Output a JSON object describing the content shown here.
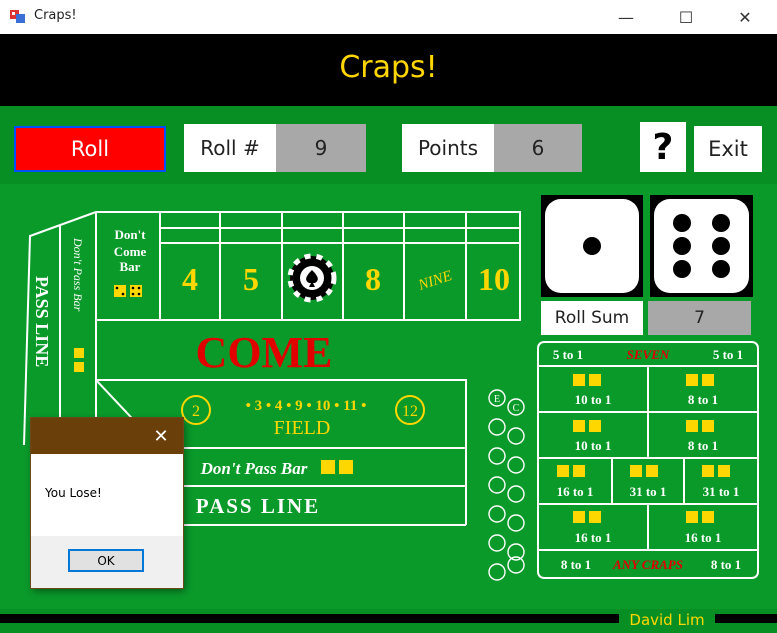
{
  "window": {
    "title": "Craps!",
    "minimize_glyph": "—",
    "maximize_glyph": "☐",
    "close_glyph": "✕"
  },
  "header": {
    "title": "Craps!"
  },
  "toolbar": {
    "roll_label": "Roll",
    "roll_number_label": "Roll  #",
    "roll_number_value": "9",
    "points_label": "Points",
    "points_value": "6",
    "help_label": "?",
    "exit_label": "Exit"
  },
  "dice": {
    "die1": 1,
    "die2": 6,
    "roll_sum_label": "Roll Sum",
    "roll_sum_value": "7"
  },
  "table": {
    "pass_line_vertical": "PASS LINE",
    "dont_pass_bar_vertical": "Don't Pass Bar",
    "dont_come_bar": [
      "Don't",
      "Come",
      "Bar"
    ],
    "place_numbers": [
      "4",
      "5",
      "8",
      "NINE",
      "10"
    ],
    "come": "COME",
    "field_start": "2",
    "field_numbers": "• 3 • 4 • 9 • 10 • 11 •",
    "field_end": "12",
    "field_label": "FIELD",
    "dont_pass_bar": "Don't Pass Bar",
    "pass_line": "PASS LINE",
    "side_letter_e": "E",
    "side_letter_c": "C"
  },
  "proposition": {
    "seven_left": "5 to 1",
    "seven_label": "SEVEN",
    "seven_right": "5 to 1",
    "hardways": [
      "10 to 1",
      "8 to 1",
      "10 to 1",
      "8 to 1"
    ],
    "horn": [
      "16 to 1",
      "31 to 1",
      "31 to 1",
      "16 to 1",
      "16 to 1"
    ],
    "any_craps_left": "8 to 1",
    "any_craps_label": "ANY CRAPS",
    "any_craps_right": "8 to 1"
  },
  "footer": {
    "author": "David Lim"
  },
  "dialog": {
    "message": "You Lose!",
    "ok_label": "OK",
    "close_glyph": "✕"
  },
  "colors": {
    "felt": "#0a9a2a",
    "gold": "#ffd700",
    "red": "#e00000",
    "roll_button": "#ff0000",
    "dialog_title": "#6b3f0a"
  }
}
